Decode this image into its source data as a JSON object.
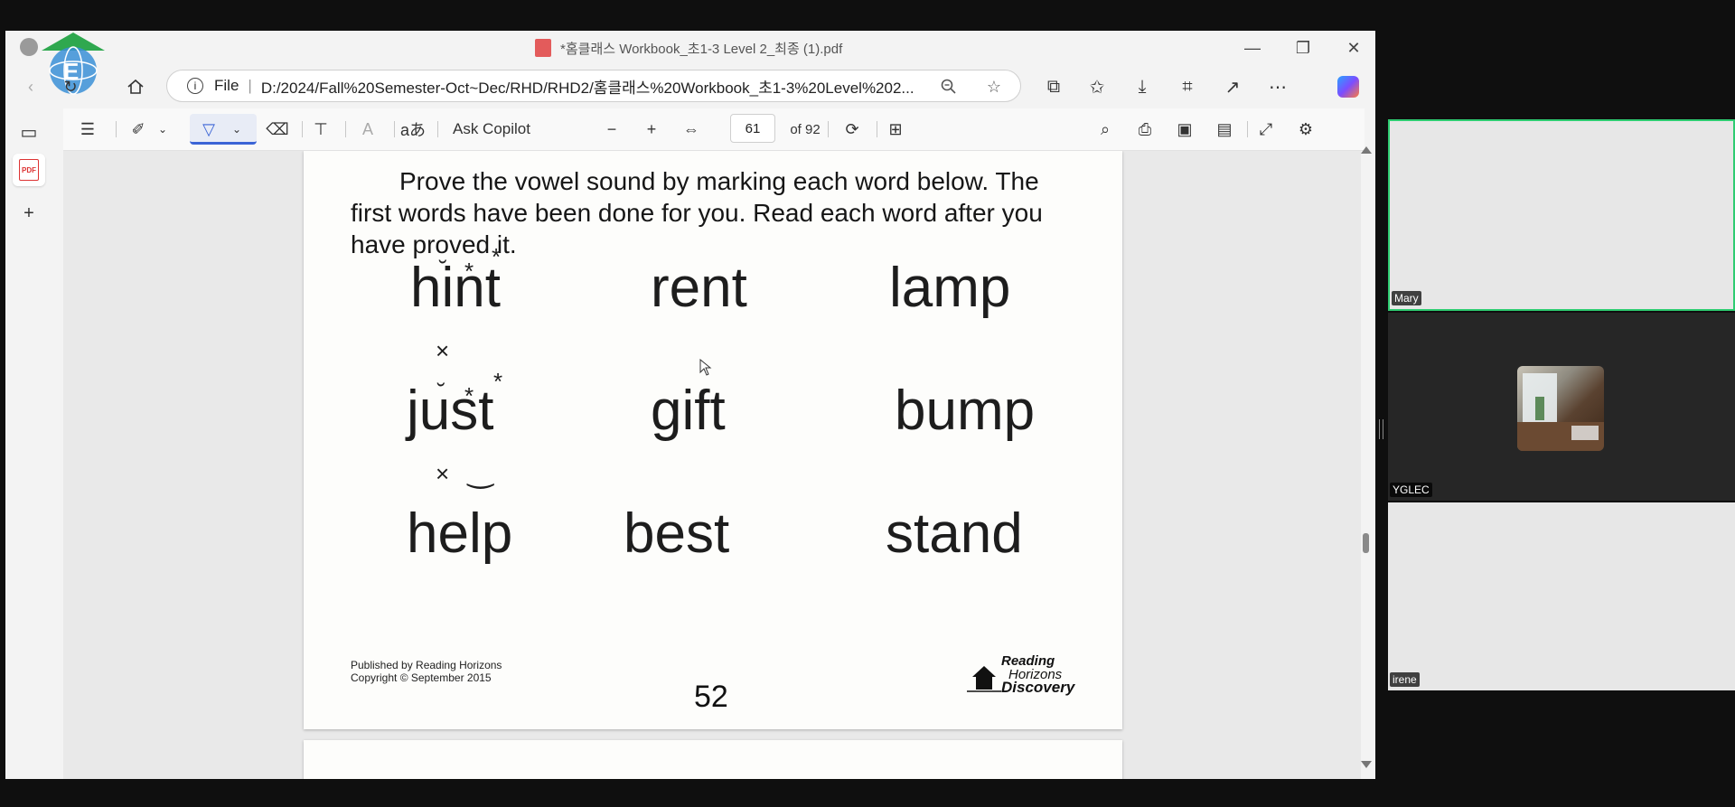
{
  "window": {
    "title": "*홈클래스 Workbook_초1-3 Level 2_최종 (1).pdf",
    "controls": {
      "minimize": "—",
      "restore": "❐",
      "close": "✕"
    }
  },
  "address_bar": {
    "protocol": "File",
    "url": "D:/2024/Fall%20Semester-Oct~Dec/RHD/RHD2/홈클래스%20Workbook_초1-3%20Level%202..."
  },
  "pdf_toolbar": {
    "ask_copilot": "Ask Copilot",
    "page_current": "61",
    "page_total": "of 92"
  },
  "document": {
    "instruction": "Prove the vowel sound by marking each word below. The first words have been done for you. Read each word after you have proved it.",
    "words": {
      "r1c1": "hint",
      "r1c2": "rent",
      "r1c3": "lamp",
      "r2c1": "just",
      "r2c2": "gift",
      "r2c3": "bump",
      "r3c1": "help",
      "r3c2": "best",
      "r3c3": "stand"
    },
    "marks": {
      "breve": "˘",
      "star": "*",
      "cross": "×",
      "smile": "‿"
    },
    "publisher_line1": "Published by Reading Horizons",
    "publisher_line2": "Copyright © September 2015",
    "page_number": "52",
    "brand_line1": "Reading",
    "brand_line2": "Horizons",
    "brand_line3": "Discovery"
  },
  "participants": [
    {
      "name": "Mary",
      "highlight_color": "#2ecc71"
    },
    {
      "name": "YGLEC"
    },
    {
      "name": "irene"
    }
  ],
  "colors": {
    "active_tool": "#3b64d6",
    "speaker_border": "#2ecc71"
  }
}
